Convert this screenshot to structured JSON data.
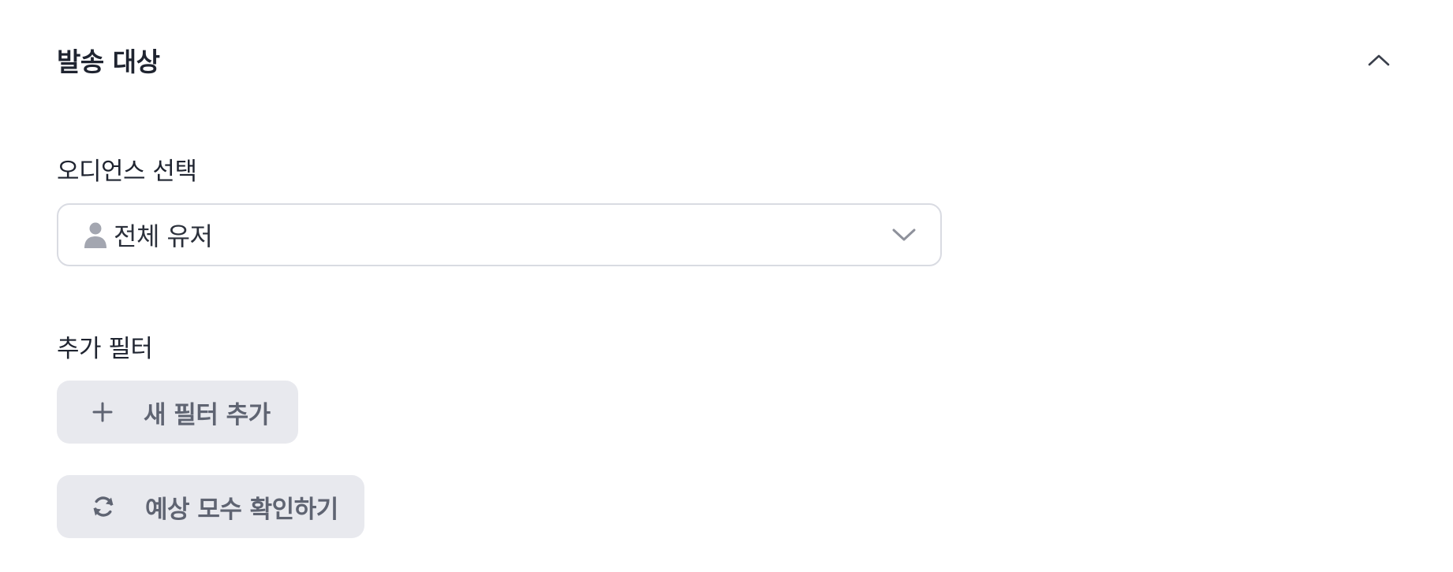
{
  "section": {
    "title": "발송 대상",
    "collapse_icon": "chevron-up-icon"
  },
  "audience": {
    "label": "오디언스 선택",
    "selected": "전체 유저",
    "icon": "person-icon",
    "dropdown_icon": "chevron-down-icon"
  },
  "filters": {
    "label": "추가 필터",
    "add_button": "새 필터 추가",
    "add_icon": "plus-icon"
  },
  "estimate": {
    "button": "예상 모수 확인하기",
    "icon": "refresh-icon"
  },
  "colors": {
    "text_primary": "#1f2430",
    "text_muted": "#5f6472",
    "icon_gray": "#a3a6b0",
    "border": "#d9dbe2",
    "button_bg": "#e8e9ee"
  }
}
